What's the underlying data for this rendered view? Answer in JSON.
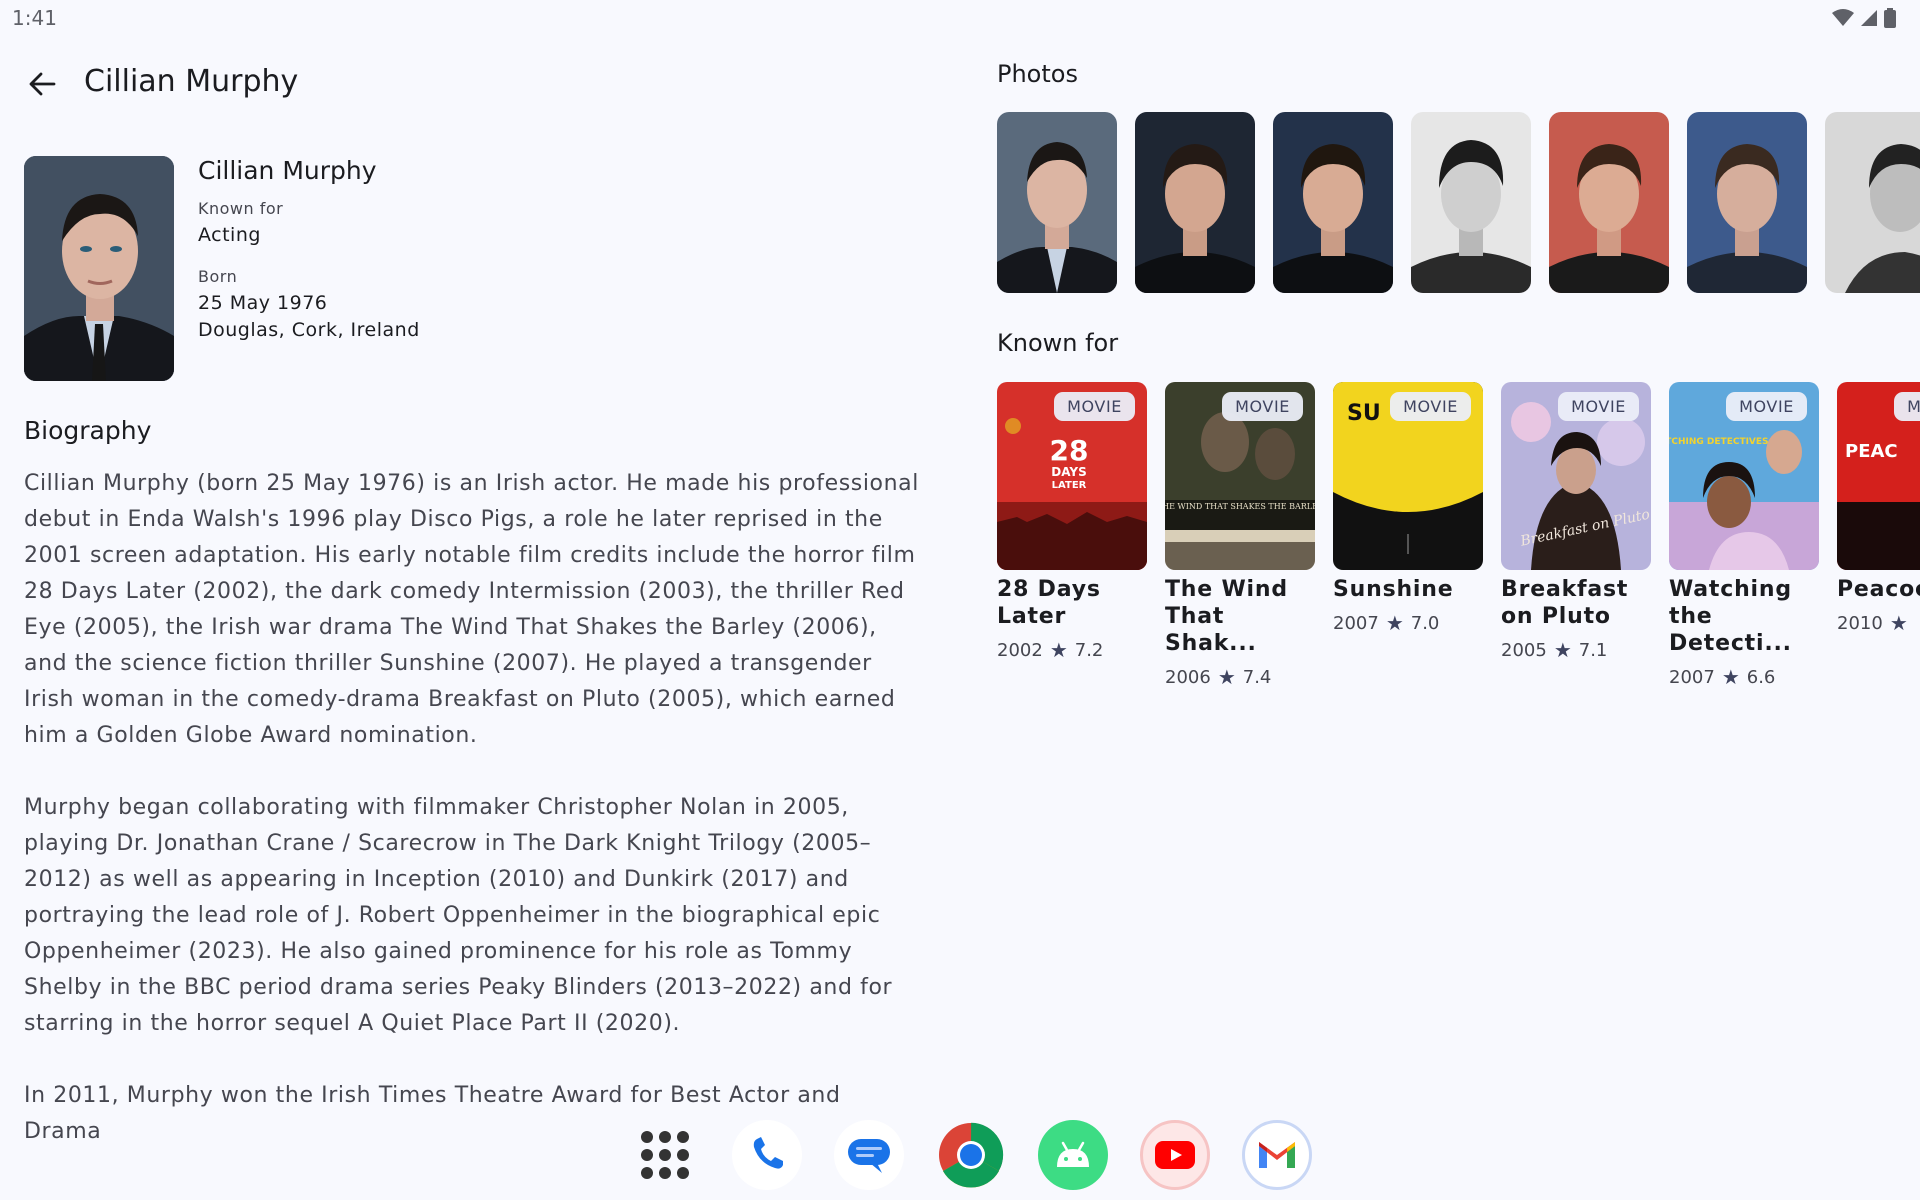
{
  "status_bar": {
    "time": "1:41"
  },
  "header": {
    "title": "Cillian Murphy"
  },
  "profile": {
    "name": "Cillian Murphy",
    "known_for_label": "Known for",
    "known_for_value": "Acting",
    "born_label": "Born",
    "born_date": "25 May 1976",
    "born_place": "Douglas, Cork, Ireland"
  },
  "biography": {
    "heading": "Biography",
    "paragraphs": [
      "Cillian Murphy (born 25 May 1976) is an Irish actor. He made his professional debut in Enda Walsh's 1996 play Disco Pigs, a role he later reprised in the 2001 screen adaptation. His early notable film credits include the horror film 28 Days Later (2002), the dark comedy Intermission (2003), the thriller Red Eye (2005), the Irish war drama The Wind That Shakes the Barley (2006), and the science fiction thriller Sunshine (2007). He played a transgender Irish woman in the comedy-drama Breakfast on Pluto (2005), which earned him a Golden Globe Award nomination.",
      "Murphy began collaborating with filmmaker Christopher Nolan in 2005, playing Dr. Jonathan Crane / Scarecrow in The Dark Knight Trilogy (2005–2012) as well as appearing in Inception (2010) and Dunkirk (2017) and portraying the lead role of J. Robert Oppenheimer in the biographical epic Oppenheimer (2023). He also gained prominence for his role as Tommy Shelby in the BBC period drama series Peaky Blinders (2013–2022) and for starring in the horror sequel A Quiet Place Part II (2020).",
      "In 2011, Murphy won the Irish Times Theatre Award for Best Actor and Drama"
    ]
  },
  "photos": {
    "heading": "Photos"
  },
  "known_for": {
    "heading": "Known for",
    "chip": "MOVIE",
    "star": "★",
    "items": [
      {
        "title": "28 Days Later",
        "year": "2002",
        "rating": "7.2"
      },
      {
        "title": "The Wind That Shak...",
        "year": "2006",
        "rating": "7.4"
      },
      {
        "title": "Sunshine",
        "year": "2007",
        "rating": "7.0"
      },
      {
        "title": "Breakfast on Pluto",
        "year": "2005",
        "rating": "7.1"
      },
      {
        "title": "Watching the Detecti...",
        "year": "2007",
        "rating": "6.6"
      },
      {
        "title": "Peacoc",
        "year": "2010",
        "rating": ""
      }
    ]
  },
  "poster_texts": {
    "days_28": "28",
    "days_28b": "DAYS",
    "days_28c": "LATER",
    "wind": "THE WIND THAT SHAKES THE BARLEY",
    "sunshine": "SU",
    "pluto": "Breakfast on Pluto",
    "detectives": "WATCHING DETECTIVES",
    "peacock": "PEAC"
  },
  "dock": {
    "apps": [
      "app-drawer",
      "phone",
      "messages",
      "chrome",
      "android-studio",
      "youtube",
      "gmail"
    ]
  }
}
